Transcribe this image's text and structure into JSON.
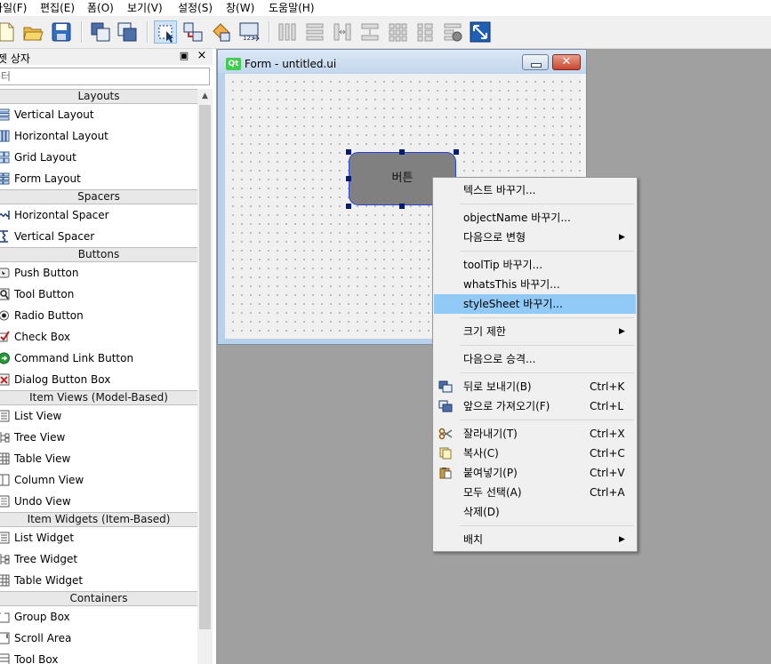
{
  "menubar": {
    "items": [
      "파일(F)",
      "편집(E)",
      "폼(O)",
      "보기(V)",
      "설정(S)",
      "창(W)",
      "도움말(H)"
    ]
  },
  "toolbar": {
    "icons": [
      "new-file-icon",
      "open-folder-icon",
      "save-icon",
      "send-to-back-icon",
      "bring-to-front-icon",
      "edit-widgets-icon",
      "edit-signals-slots-icon",
      "edit-buddies-icon",
      "edit-tab-order-icon",
      "layout-horizontal-icon",
      "layout-vertical-icon",
      "layout-horizontal-splitter-icon",
      "layout-vertical-splitter-icon",
      "layout-grid-icon",
      "layout-form-icon",
      "break-layout-icon",
      "adjust-size-icon"
    ]
  },
  "widget_box": {
    "title": "위젯 상자",
    "filter_placeholder": "필터",
    "categories": [
      {
        "label": "Layouts"
      },
      {
        "label": "Spacers"
      },
      {
        "label": "Buttons"
      },
      {
        "label": "Item Views (Model-Based)"
      },
      {
        "label": "Item Widgets (Item-Based)"
      },
      {
        "label": "Containers"
      }
    ],
    "items": [
      {
        "label": "Vertical Layout"
      },
      {
        "label": "Horizontal Layout"
      },
      {
        "label": "Grid Layout"
      },
      {
        "label": "Form Layout"
      },
      {
        "label": "Horizontal Spacer"
      },
      {
        "label": "Vertical Spacer"
      },
      {
        "label": "Push Button"
      },
      {
        "label": "Tool Button"
      },
      {
        "label": "Radio Button"
      },
      {
        "label": "Check Box"
      },
      {
        "label": "Command Link Button"
      },
      {
        "label": "Dialog Button Box"
      },
      {
        "label": "List View"
      },
      {
        "label": "Tree View"
      },
      {
        "label": "Table View"
      },
      {
        "label": "Column View"
      },
      {
        "label": "Undo View"
      },
      {
        "label": "List Widget"
      },
      {
        "label": "Tree Widget"
      },
      {
        "label": "Table Widget"
      },
      {
        "label": "Group Box"
      },
      {
        "label": "Scroll Area"
      },
      {
        "label": "Tool Box"
      }
    ]
  },
  "form_window": {
    "logo": "Qt",
    "title": "Form - untitled.ui",
    "button_label": "버튼",
    "close_glyph": "✕"
  },
  "context_menu": {
    "items": [
      {
        "label": "텍스트 바꾸기..."
      },
      {
        "label": "objectName 바꾸기..."
      },
      {
        "label": "다음으로 변형",
        "submenu": true
      },
      {
        "label": "toolTip 바꾸기..."
      },
      {
        "label": "whatsThis 바꾸기..."
      },
      {
        "label": "styleSheet 바꾸기...",
        "highlighted": true
      },
      {
        "label": "크기 제한",
        "submenu": true
      },
      {
        "label": "다음으로 승격..."
      },
      {
        "label": "뒤로 보내기(B)",
        "shortcut": "Ctrl+K"
      },
      {
        "label": "앞으로 가져오기(F)",
        "shortcut": "Ctrl+L"
      },
      {
        "label": "잘라내기(T)",
        "shortcut": "Ctrl+X"
      },
      {
        "label": "복사(C)",
        "shortcut": "Ctrl+C"
      },
      {
        "label": "붙여넣기(P)",
        "shortcut": "Ctrl+V"
      },
      {
        "label": "모두 선택(A)",
        "shortcut": "Ctrl+A"
      },
      {
        "label": "삭제(D)"
      },
      {
        "label": "배치",
        "submenu": true
      }
    ],
    "submenu_glyph": "▶"
  },
  "colors": {
    "highlight": "#91c9f7",
    "selection_border": "#2a3fd8",
    "form_button_fill": "#808080",
    "mdi_background": "#a0a0a0"
  }
}
